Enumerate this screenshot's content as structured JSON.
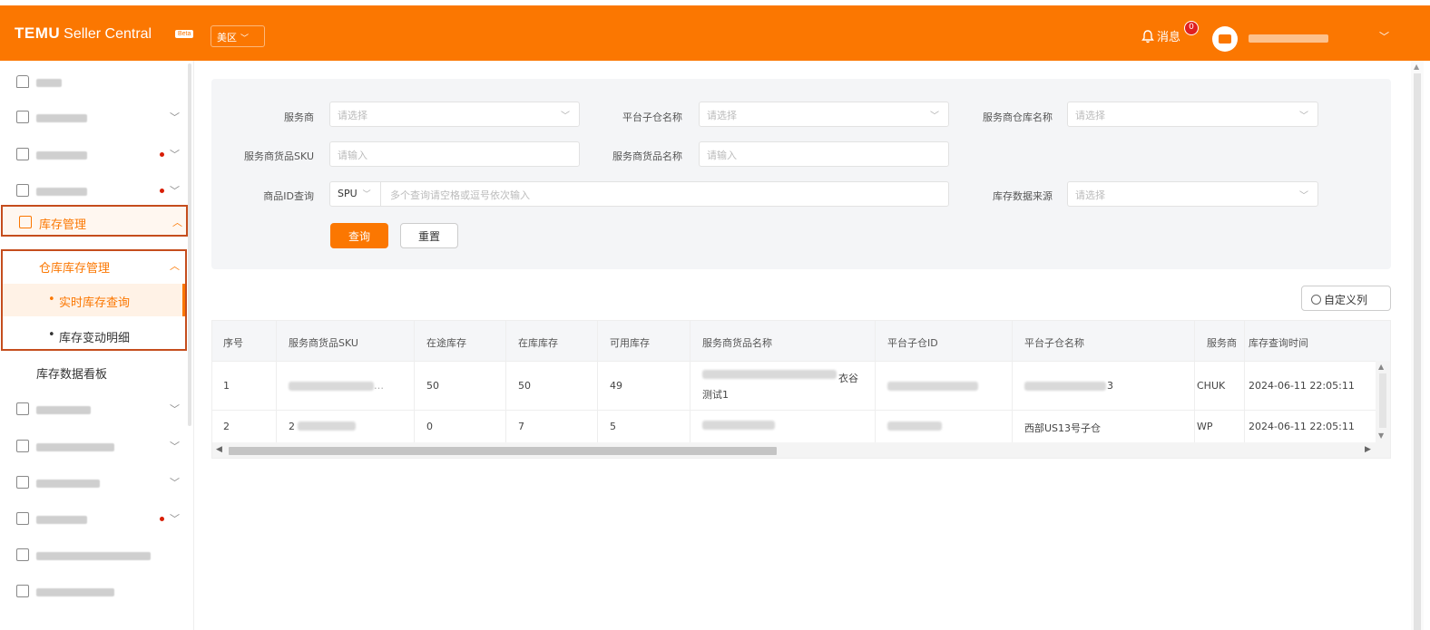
{
  "header": {
    "logo_temu": "TEMU",
    "logo_sc": "Seller Central",
    "beta": "Beta",
    "region": "美区",
    "messages_label": "消息",
    "messages_badge": "0"
  },
  "colors": {
    "brand": "#fb7701",
    "active_outline": "#c54d1d",
    "badge": "#e02020"
  },
  "sidebar": {
    "inventory": "库存管理",
    "warehouse": "仓库库存管理",
    "realtime": "实时库存查询",
    "changes": "库存变动明细",
    "dashboard": "库存数据看板",
    "bullet": "•"
  },
  "filters": {
    "service_provider": {
      "label": "服务商",
      "placeholder": "请选择"
    },
    "platform_sub_wh": {
      "label": "平台子仓名称",
      "placeholder": "请选择"
    },
    "provider_wh_name": {
      "label": "服务商仓库名称",
      "placeholder": "请选择"
    },
    "provider_sku": {
      "label": "服务商货品SKU",
      "placeholder": "请输入"
    },
    "provider_item_name": {
      "label": "服务商货品名称",
      "placeholder": "请输入"
    },
    "product_id": {
      "label": "商品ID查询",
      "type_value": "SPU",
      "placeholder": "多个查询请空格或逗号依次输入"
    },
    "data_source": {
      "label": "库存数据来源",
      "placeholder": "请选择"
    },
    "query_button": "查询",
    "reset_button": "重置"
  },
  "custom_columns": "自定义列",
  "table": {
    "headers": [
      "序号",
      "服务商货品SKU",
      "在途库存",
      "在库库存",
      "可用库存",
      "服务商货品名称",
      "平台子仓ID",
      "平台子仓名称",
      "服务商",
      "库存查询时间"
    ],
    "rows": [
      {
        "no": "1",
        "sku_tail": "…",
        "in_transit": "50",
        "in_stock": "50",
        "available": "49",
        "name_tail": "衣谷",
        "name_line2": "测试1",
        "wh_name_tail": "3",
        "provider": "CHUK",
        "time": "2024-06-11 22:05:11"
      },
      {
        "no": "2",
        "sku_head": "2",
        "in_transit": "0",
        "in_stock": "7",
        "available": "5",
        "wh_name": "西部US13号子仓",
        "provider": "WP",
        "time": "2024-06-11 22:05:11"
      }
    ]
  }
}
